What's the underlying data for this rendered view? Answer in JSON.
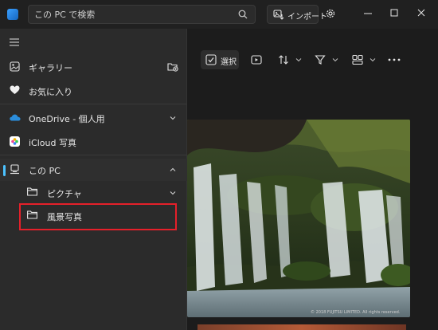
{
  "search": {
    "placeholder": "この PC で検索"
  },
  "header": {
    "import_label": "インポート"
  },
  "toolbar": {
    "select_label": "選択"
  },
  "nav": {
    "gallery": "ギャラリー",
    "favorites": "お気に入り",
    "onedrive": "OneDrive - 個人用",
    "icloud": "iCloud 写真",
    "this_pc": "この PC",
    "pictures": "ピクチャ",
    "landscape": "風景写真"
  },
  "photo": {
    "watermark": "© 2018 FUJITSU LIMITED. All rights reserved."
  },
  "colors": {
    "accent": "#4cc2ff",
    "highlight": "#e5202a",
    "nav_bg": "#2b2b2b",
    "app_bg": "#1c1c1c"
  }
}
